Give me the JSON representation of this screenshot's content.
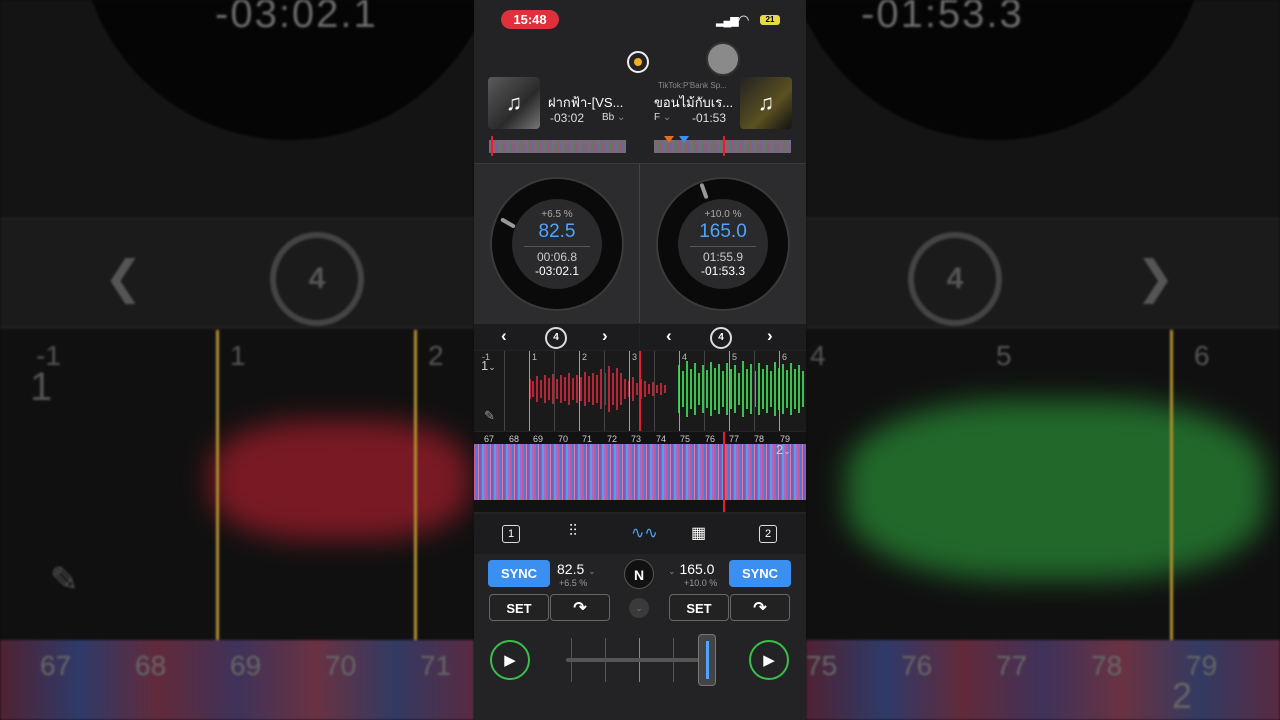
{
  "background": {
    "left_time": "-03:02.1",
    "right_time": "-01:53.3",
    "loop_value": "4",
    "left_beats": [
      "1",
      "2"
    ],
    "left_beat_neg": "-1",
    "left_deck_label": "1",
    "right_beats": [
      "4",
      "5",
      "6"
    ],
    "left_bars": [
      "67",
      "68",
      "69",
      "70",
      "71"
    ],
    "right_bars": [
      "75",
      "76",
      "77",
      "78",
      "79"
    ],
    "right_deck_label": "2"
  },
  "status_bar": {
    "time": "15:48",
    "battery": "21"
  },
  "deck_a": {
    "title": "ฝากฟ้า-[VS...",
    "time_remaining": "-03:02",
    "key": "Bb",
    "pitch_percent": "+6.5 %",
    "bpm": "82.5",
    "elapsed": "00:06.8",
    "remaining_precise": "-03:02.1",
    "loop_size": "4",
    "sync_label": "SYNC",
    "set_label": "SET",
    "bpm_display": "82.5",
    "pitch_small": "+6.5 %",
    "deck_label": "1",
    "beat_neg": "-1"
  },
  "deck_b": {
    "title": "ขอนไม้กับเร...",
    "artist": "TikTok:P'Bank Sp...",
    "time_remaining": "-01:53",
    "key": "F",
    "pitch_percent": "+10.0 %",
    "bpm": "165.0",
    "elapsed": "01:55.9",
    "remaining_precise": "-01:53.3",
    "loop_size": "4",
    "sync_label": "SYNC",
    "set_label": "SET",
    "bpm_display": "165.0",
    "pitch_small": "+10.0 %",
    "deck_label": "2"
  },
  "waveform_top": {
    "beats": [
      "1",
      "2",
      "3",
      "4",
      "5",
      "6"
    ]
  },
  "waveform_bottom": {
    "bars": [
      "67",
      "68",
      "69",
      "70",
      "71",
      "72",
      "73",
      "74",
      "75",
      "76",
      "77",
      "78",
      "79"
    ]
  },
  "tabs": {
    "deck1": "1",
    "deck2": "2"
  },
  "center": {
    "n_label": "N"
  },
  "icons": {
    "play": "play-icon",
    "music": "music-note-icon",
    "loop": "loop-icon",
    "record": "record-icon",
    "cue": "cue-arrow-icon",
    "mixer": "mixer-icon",
    "waveform": "waveform-icon",
    "pads": "pads-grid-icon"
  },
  "colors": {
    "accent_blue": "#4ea4ff",
    "sync_blue": "#3a8ff0",
    "play_green": "#38c048",
    "time_pill_red": "#e0303c",
    "cursor_red": "#e02030",
    "beat_gold": "#c8a030"
  }
}
